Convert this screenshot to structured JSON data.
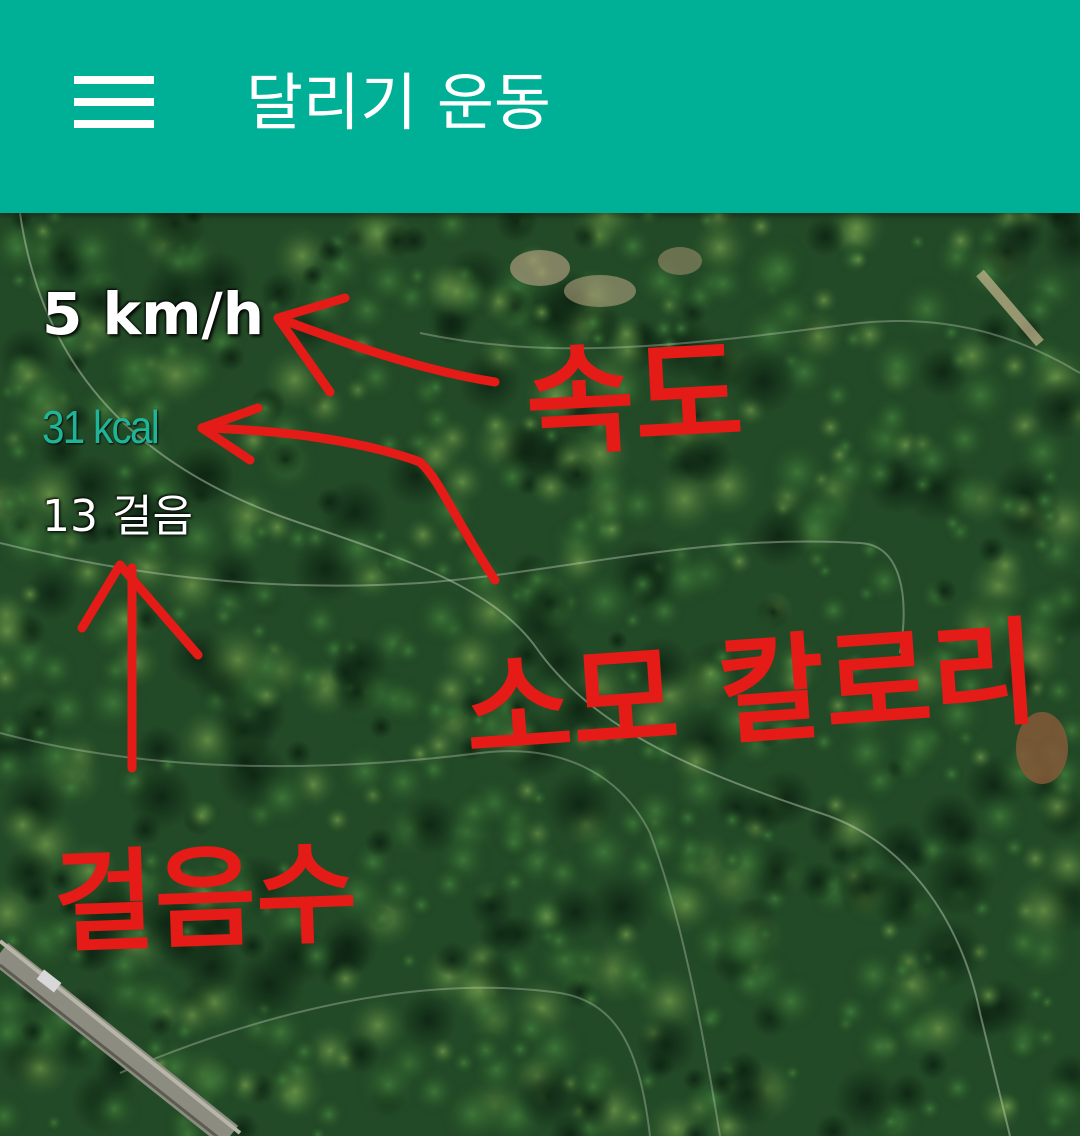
{
  "app_bar": {
    "menu_icon": "hamburger-menu-icon",
    "title": "달리기 운동",
    "color": "#00b096"
  },
  "stats": {
    "speed": "5 km/h",
    "calories": "31 kcal",
    "steps": "13 걸음",
    "calories_color": "#1fb497"
  },
  "annotations": {
    "speed_label": "속도",
    "calories_label": "소모 칼로리",
    "steps_label": "걸음수",
    "color": "#e41b17"
  },
  "map": {
    "type": "satellite",
    "terrain": "forest"
  }
}
